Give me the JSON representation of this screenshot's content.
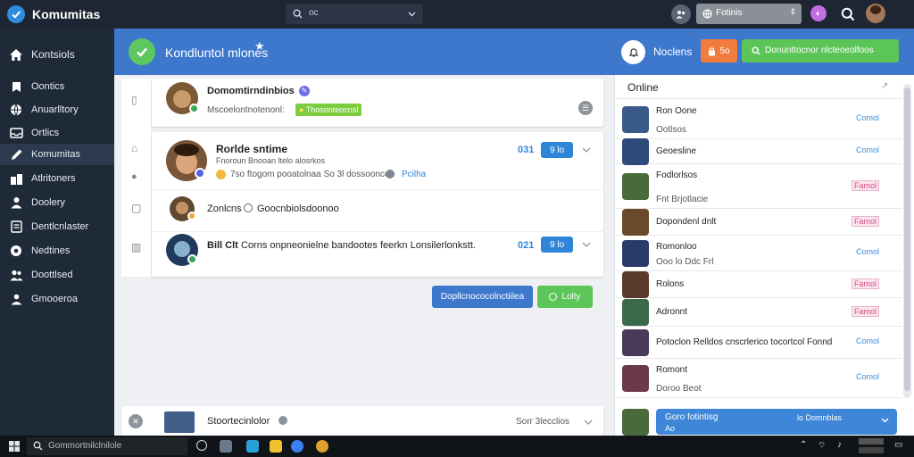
{
  "app": {
    "title": "Komumitas"
  },
  "topbar": {
    "search_value": "oc",
    "filter_label": "Fotinis"
  },
  "sidebar": {
    "items": [
      {
        "label": "Kontsiols",
        "icon": "home-icon"
      },
      {
        "label": "Oontics",
        "icon": "bookmark-icon"
      },
      {
        "label": "Anuarlltory",
        "icon": "globe-icon"
      },
      {
        "label": "Ortlics",
        "icon": "tray-icon"
      },
      {
        "label": "Komumitas",
        "icon": "pencil-icon"
      },
      {
        "label": "Atlritoners",
        "icon": "building-icon"
      },
      {
        "label": "Doolery",
        "icon": "person-icon"
      },
      {
        "label": "Dentlcnlaster",
        "icon": "document-icon"
      },
      {
        "label": "Nedtines",
        "icon": "gear-icon"
      },
      {
        "label": "Doottlsed",
        "icon": "people-icon"
      },
      {
        "label": "Gmooeroa",
        "icon": "users-icon"
      }
    ]
  },
  "header": {
    "title": "Kondluntol mlones",
    "notifications_label": "Noclens",
    "orange_button_label": "5o",
    "green_button_label": "Donunttocnor nlcteoeolfoos"
  },
  "feed": {
    "top_post": {
      "name": "Domomtirndinbios",
      "meta": "Mscoelontnotenonl:",
      "tag": "Thosonteocnsl"
    },
    "post": {
      "name": "Rorlde sntime",
      "sub": "Fnoroun Bnooan ltelo alosrkos",
      "meta": "7so ftogom pooatolnaa So 3l dossooncee",
      "link": "Pcilha",
      "count": "031",
      "badge": "9 lo"
    },
    "reply1": {
      "name": "Zonlcns",
      "text": "Goocnbiolsdoonoo"
    },
    "reply2": {
      "name": "Bill Clt",
      "text": "Corns onpneonielne bandootes feerkn Lonsilerlonkstt.",
      "count": "021",
      "badge": "9 lo"
    },
    "blue_button_label": "Dopllcnococolnctiilea",
    "green_button_label": "Lolty",
    "bottom": {
      "name": "Stoortecinlolor",
      "meta": "Sorr 3lecclios"
    }
  },
  "right_panel": {
    "title": "Online",
    "items": [
      {
        "name": "Ron Oone",
        "sub": "Ootlsos",
        "tag": "Comol",
        "pink": false
      },
      {
        "name": "Geoesline",
        "sub": "",
        "tag": "Comol",
        "pink": false
      },
      {
        "name": "Fodlorlsos",
        "sub": "Fnt Brjotlacie",
        "tag": "Famol",
        "pink": true
      },
      {
        "name": "Dopondenl dnlt",
        "sub": "",
        "tag": "Famol",
        "pink": true
      },
      {
        "name": "Romonloo",
        "sub": "Ooo lo Ddc Frl",
        "tag": "Comol",
        "pink": false
      },
      {
        "name": "Rolons",
        "sub": "",
        "tag": "Famol",
        "pink": true
      },
      {
        "name": "Adronnt",
        "sub": "",
        "tag": "Famol",
        "pink": true
      },
      {
        "name": "Potoclon Relldos cnscrlerico tocortcol Fonnd",
        "sub": "",
        "tag": "Comol",
        "pink": false
      },
      {
        "name": "Romont",
        "sub": "Doroo Beot",
        "tag": "Comol",
        "pink": false
      }
    ],
    "chat_bar": {
      "title": "Goro fotintisg",
      "sub": "Ao",
      "right": "lo Domnblas"
    }
  },
  "taskbar": {
    "search_placeholder": "Gommortnilclnilole"
  }
}
